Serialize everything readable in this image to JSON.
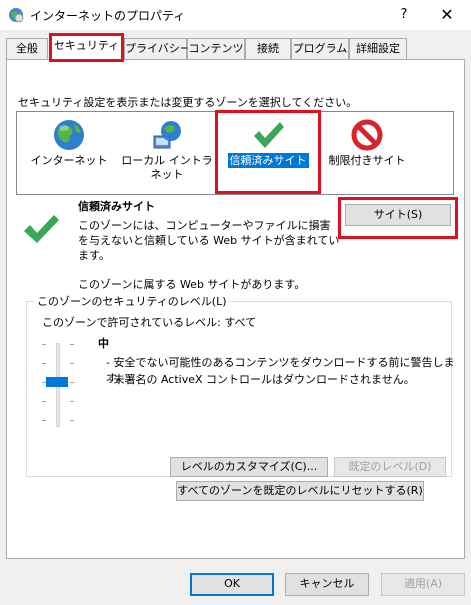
{
  "window": {
    "title": "インターネットのプロパティ",
    "help": "?",
    "close": "✕"
  },
  "tabs": [
    {
      "label": "全般"
    },
    {
      "label": "セキュリティ"
    },
    {
      "label": "プライバシー"
    },
    {
      "label": "コンテンツ"
    },
    {
      "label": "接続"
    },
    {
      "label": "プログラム"
    },
    {
      "label": "詳細設定"
    }
  ],
  "security": {
    "instruction": "セキュリティ設定を表示または変更するゾーンを選択してください。",
    "zones": [
      {
        "label": "インターネット",
        "icon": "globe-icon"
      },
      {
        "label": "ローカル イントラネット",
        "icon": "intranet-globe-icon"
      },
      {
        "label": "信頼済みサイト",
        "icon": "checkmark-icon"
      },
      {
        "label": "制限付きサイト",
        "icon": "prohibited-icon"
      }
    ],
    "selected_zone": {
      "name": "信頼済みサイト",
      "description": "このゾーンには、コンピューターやファイルに損害を与えないと信頼している Web サイトが含まれています。",
      "sites_button": "サイト(S)",
      "has_sites": "このゾーンに属する Web サイトがあります。"
    },
    "level_group": {
      "legend": "このゾーンのセキュリティのレベル(L)",
      "allowed": "このゾーンで許可されているレベル: すべて",
      "level_name": "中",
      "bullets": [
        "- 安全でない可能性のあるコンテンツをダウンロードする前に警告します。",
        "- 未署名の ActiveX コントロールはダウンロードされません。"
      ],
      "level_fraction": 0.5,
      "customize_button": "レベルのカスタマイズ(C)...",
      "default_button": "既定のレベル(D)"
    },
    "reset_all_button": "すべてのゾーンを既定のレベルにリセットする(R)"
  },
  "footer": {
    "ok": "OK",
    "cancel": "キャンセル",
    "apply": "適用(A)"
  },
  "colors": {
    "accent": "#0078d7",
    "highlight_box": "#e0101c",
    "check_green": "#3aa65a"
  }
}
